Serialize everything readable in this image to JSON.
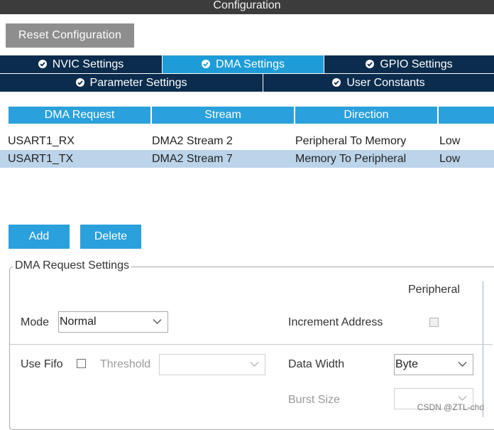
{
  "window": {
    "title": "Configuration"
  },
  "toolbar": {
    "reset_label": "Reset Configuration"
  },
  "tabs": {
    "row1": [
      {
        "label": "NVIC Settings"
      },
      {
        "label": "DMA Settings",
        "active": true
      },
      {
        "label": "GPIO Settings"
      }
    ],
    "row2": [
      {
        "label": "Parameter Settings"
      },
      {
        "label": "User Constants"
      }
    ]
  },
  "dma_table": {
    "columns": [
      "DMA Request",
      "Stream",
      "Direction",
      ""
    ],
    "rows": [
      {
        "request": "USART1_RX",
        "stream": "DMA2 Stream 2",
        "direction": "Peripheral To Memory",
        "priority": "Low",
        "selected": false
      },
      {
        "request": "USART1_TX",
        "stream": "DMA2 Stream 7",
        "direction": "Memory To Peripheral",
        "priority": "Low",
        "selected": true
      }
    ]
  },
  "actions": {
    "add_label": "Add",
    "delete_label": "Delete"
  },
  "settings": {
    "title": "DMA Request Settings",
    "peripheral_header": "Peripheral",
    "mode_label": "Mode",
    "mode_value": "Normal",
    "increment_label": "Increment Address",
    "use_fifo_label": "Use Fifo",
    "threshold_label": "Threshold",
    "threshold_value": "",
    "data_width_label": "Data Width",
    "data_width_value": "Byte",
    "burst_size_label": "Burst Size",
    "burst_size_value": ""
  },
  "watermark": "CSDN @ZTL-chd",
  "colors": {
    "tab_dark": "#0b2c4d",
    "accent": "#1e9cd8",
    "selected_row": "#bcd4ea"
  }
}
